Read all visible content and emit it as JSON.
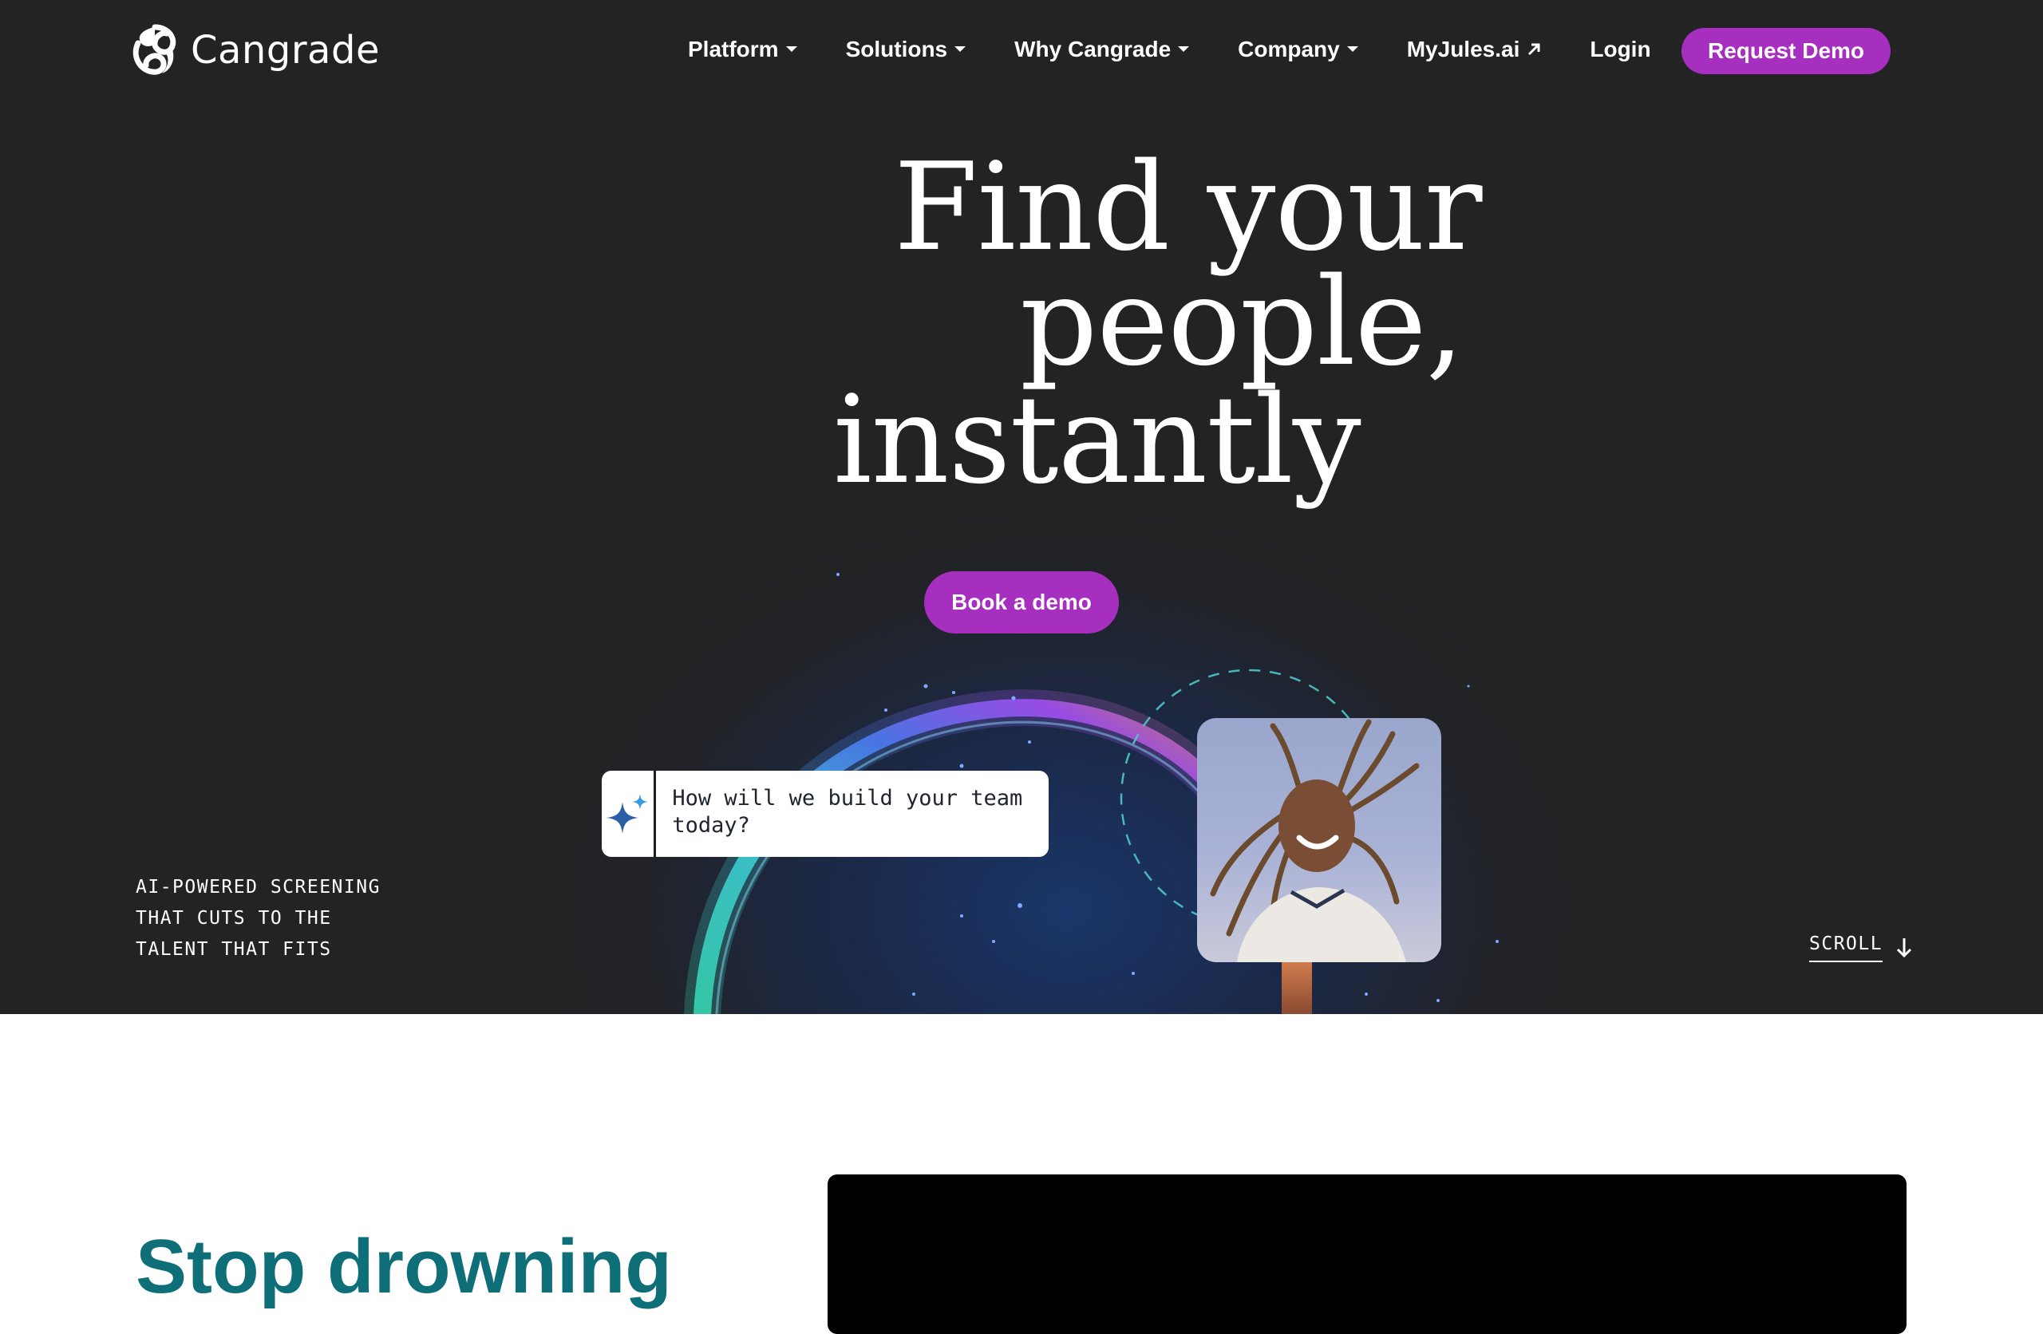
{
  "brand": {
    "name": "Cangrade"
  },
  "nav": {
    "items": [
      {
        "label": "Platform",
        "icon": "caret-down-icon"
      },
      {
        "label": "Solutions",
        "icon": "caret-down-icon"
      },
      {
        "label": "Why Cangrade",
        "icon": "caret-down-icon"
      },
      {
        "label": "Company",
        "icon": "caret-down-icon"
      },
      {
        "label": "MyJules.ai",
        "icon": "external-link-icon"
      },
      {
        "label": "Login"
      }
    ],
    "cta_label": "Request Demo"
  },
  "hero": {
    "headline_lines": [
      "Find your",
      "people,",
      "instantly"
    ],
    "cta_label": "Book a demo",
    "chat_prompt": "How will we build your team today?",
    "chat_icon": "sparkle-icon",
    "tagline": "AI-POWERED SCREENING THAT CUTS TO THE TALENT THAT FITS",
    "scroll_label": "SCROLL",
    "photo": "smiling-woman-portrait"
  },
  "section": {
    "title": "Stop drowning"
  },
  "colors": {
    "accent": "#a72fc0",
    "hero_bg": "#232323",
    "section_title": "#0e6f78"
  }
}
